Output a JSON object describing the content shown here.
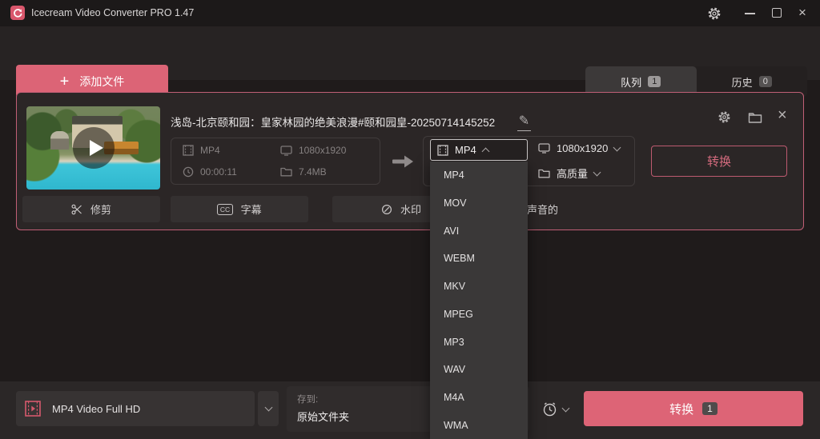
{
  "window": {
    "title": "Icecream Video Converter PRO 1.47"
  },
  "toolbar": {
    "add_files_label": "添加文件",
    "tabs": [
      {
        "label": "队列",
        "count": "1"
      },
      {
        "label": "历史",
        "count": "0"
      }
    ]
  },
  "file_card": {
    "filename": "浅岛-北京颐和园：皇家林园的绝美浪漫#颐和园皇-20250714145252",
    "source": {
      "format": "MP4",
      "resolution": "1080x1920",
      "duration": "00:00:11",
      "size": "7.4MB"
    },
    "output": {
      "format": "MP4",
      "resolution": "1080x1920",
      "quality": "高质量"
    },
    "convert_label": "转换",
    "actions": {
      "trim": "修剪",
      "subtitles": "字幕",
      "watermark": "水印",
      "audio_partial": "声音的"
    }
  },
  "format_dropdown": {
    "selected": "MP4",
    "options": [
      "MP4",
      "MOV",
      "AVI",
      "WEBM",
      "MKV",
      "MPEG",
      "MP3",
      "WAV",
      "M4A",
      "WMA"
    ]
  },
  "bottom_bar": {
    "preset": "MP4 Video Full HD",
    "save_to_label": "存到:",
    "save_to_value": "原始文件夹",
    "convert_label": "转换",
    "convert_count": "1"
  },
  "icons": {
    "plus": "+",
    "close": "×",
    "cc": "CC",
    "pencil": "✎"
  },
  "colors": {
    "accent": "#dc6476",
    "card_border": "#c05f76",
    "panel_dark": "#1f1b1b",
    "dropdown_bg": "#3a3838"
  }
}
